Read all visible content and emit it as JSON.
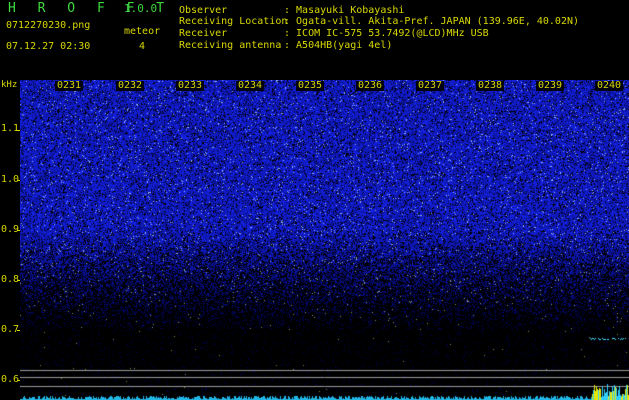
{
  "app": {
    "title": "H R O F F T",
    "version": "1.0.0",
    "filename": "0712270230.png",
    "timestamp": "07.12.27 02:30",
    "meteor_label": "meteor",
    "meteor_count": "4"
  },
  "info": [
    {
      "label": "Observer",
      "value": ": Masayuki Kobayashi"
    },
    {
      "label": "Receiving Location",
      "value": ": Ogata-vill. Akita-Pref. JAPAN (139.96E, 40.02N)"
    },
    {
      "label": "Receiver",
      "value": ": ICOM IC-575 53.7492(@LCD)MHz USB"
    },
    {
      "label": "Receiving antenna",
      "value": ": A504HB(yagi 4el)"
    }
  ],
  "colors": {
    "text_yellow": "#d8d800",
    "title_green": "#3fd83f",
    "signal_blue": "#2a3cff",
    "meteor_cyan": "#40e0ff"
  },
  "chart_data": {
    "type": "heatmap",
    "y_unit": "kHz",
    "y_ticks": [
      "1.1",
      "1.0",
      "0.9",
      "0.8",
      "0.7",
      "0.6"
    ],
    "x_ticks": [
      "0231",
      "0232",
      "0233",
      "0234",
      "0235",
      "0236",
      "0237",
      "0238",
      "0239",
      "0240"
    ]
  }
}
